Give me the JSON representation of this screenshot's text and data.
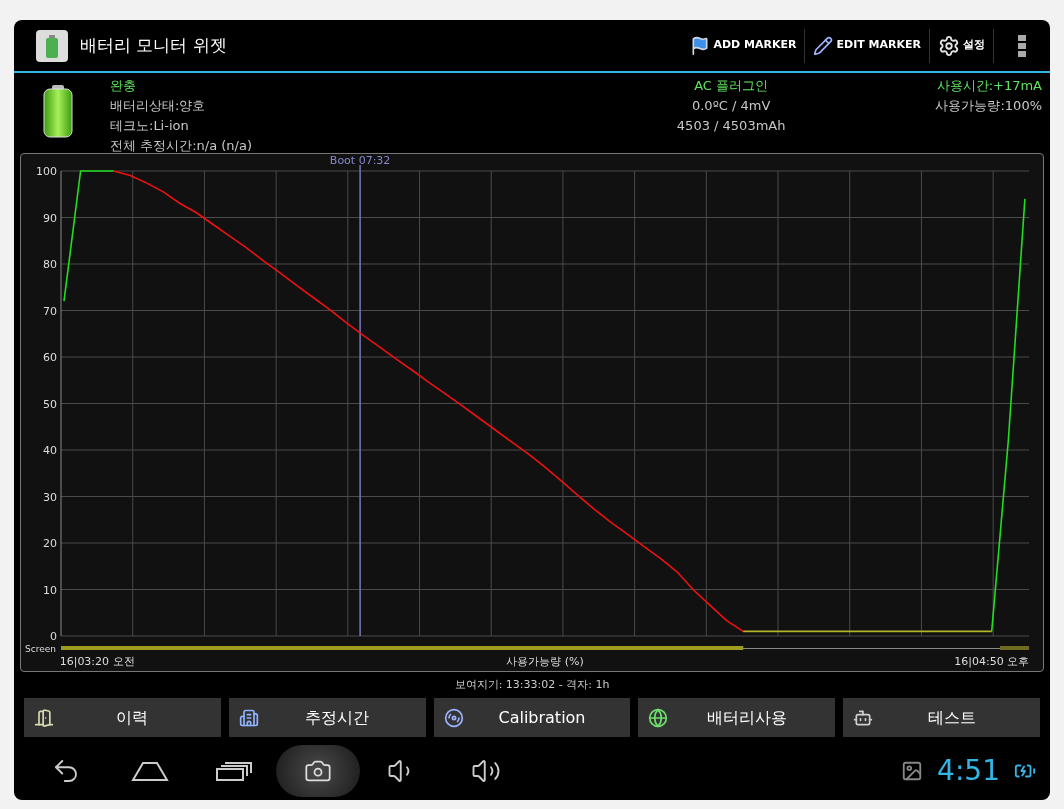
{
  "action_bar": {
    "title": "배터리 모니터 위젯",
    "actions": [
      {
        "label": "ADD MARKER",
        "kind": "flag"
      },
      {
        "label": "EDIT MARKER",
        "kind": "pencil"
      },
      {
        "label": "설정",
        "kind": "gear"
      }
    ]
  },
  "status": {
    "left": [
      {
        "text": "완충",
        "highlight": true
      },
      {
        "text": "배터리상태:양호",
        "highlight": false
      },
      {
        "text": "테크노:Li-ion",
        "highlight": false
      },
      {
        "text": "전체 추정시간:n/a (n/a)",
        "highlight": false
      }
    ],
    "center": [
      {
        "text": "AC 플러그인",
        "highlight": true
      },
      {
        "text": "0.0ºC / 4mV",
        "highlight": false
      },
      {
        "text": "4503 / 4503mAh",
        "highlight": false
      }
    ],
    "right": [
      {
        "text": "사용시간:+17mA",
        "highlight": true
      },
      {
        "text": "사용가능량:100%",
        "highlight": false
      }
    ]
  },
  "chart": {
    "screen_label": "Screen",
    "chart_data": {
      "type": "line",
      "xlabel": "사용가능량 (%)",
      "categories": [
        null,
        null,
        "16|03:20 오전",
        null,
        null,
        null,
        null,
        null,
        null,
        null,
        null,
        null,
        null,
        null,
        null,
        null,
        null,
        null,
        null,
        null,
        null,
        null,
        null,
        null,
        null,
        null,
        null,
        null,
        null,
        null,
        null,
        null,
        null,
        null,
        null,
        null,
        null,
        null,
        null,
        null,
        null,
        null,
        null,
        null,
        null,
        null,
        null,
        null,
        null,
        null,
        null,
        null,
        null,
        null,
        null,
        null,
        "16|04:50 오후",
        null,
        null
      ],
      "series": [
        {
          "color": "#22dd22",
          "values": [
            72,
            100,
            100,
            100,
            null,
            null,
            null,
            null,
            null,
            null,
            null,
            null,
            null,
            null,
            null,
            null,
            null,
            null,
            null,
            null,
            null,
            null,
            null,
            null,
            null,
            null,
            null,
            null,
            null,
            null,
            null,
            null,
            null,
            null,
            null,
            null,
            null,
            null,
            null,
            null,
            null,
            null,
            null,
            null,
            null,
            null,
            null,
            null,
            null,
            null,
            null,
            null,
            null,
            null,
            null,
            null,
            1,
            42,
            94
          ]
        },
        {
          "color": "#ee1111",
          "values": [
            null,
            null,
            null,
            100,
            99,
            97.4,
            95.5,
            93,
            91,
            88.5,
            86,
            83.5,
            80.8,
            78.2,
            75.5,
            72.9,
            70.3,
            67.5,
            64.8,
            62.3,
            59.7,
            57.2,
            54.6,
            52.1,
            49.6,
            47,
            44.4,
            41.8,
            39.2,
            36.4,
            33.4,
            30.3,
            27.3,
            24.5,
            21.9,
            19.3,
            16.7,
            13.8,
            9.9,
            6.6,
            3.3,
            1,
            null,
            null,
            null,
            null,
            null,
            null,
            null,
            null,
            null,
            null,
            null,
            null,
            null,
            null,
            null,
            null,
            null
          ]
        },
        {
          "color": "#b5b52a",
          "values": [
            null,
            null,
            null,
            null,
            null,
            null,
            null,
            null,
            null,
            null,
            null,
            null,
            null,
            null,
            null,
            null,
            null,
            null,
            null,
            null,
            null,
            null,
            null,
            null,
            null,
            null,
            null,
            null,
            null,
            null,
            null,
            null,
            null,
            null,
            null,
            null,
            null,
            null,
            null,
            null,
            null,
            1,
            1,
            1,
            1,
            1,
            1,
            1,
            1,
            1,
            1,
            1,
            1,
            1,
            1,
            1,
            1,
            null,
            null
          ]
        }
      ],
      "grid": true,
      "ylim": [
        0,
        100
      ],
      "yticks": [
        0,
        10,
        20,
        30,
        40,
        50,
        60,
        70,
        80,
        90,
        100
      ],
      "annotations": [
        "Boot 07:32"
      ]
    }
  },
  "view_info": "보여지기: 13:33:02 - 격자: 1h",
  "buttons": [
    {
      "label": "이력",
      "kind": "door"
    },
    {
      "label": "추정시간",
      "kind": "building"
    },
    {
      "label": "Calibration",
      "kind": "disc"
    },
    {
      "label": "배터리사용",
      "kind": "globe"
    },
    {
      "label": "테스트",
      "kind": "robot"
    }
  ],
  "nav_bar": {
    "buttons": [
      {
        "kind": "back",
        "selected": false
      },
      {
        "kind": "home",
        "selected": false
      },
      {
        "kind": "recents",
        "selected": false
      },
      {
        "kind": "screenshot",
        "selected": true
      },
      {
        "kind": "volume_down",
        "selected": false
      },
      {
        "kind": "volume_up",
        "selected": false
      }
    ],
    "clock": "4:51"
  }
}
